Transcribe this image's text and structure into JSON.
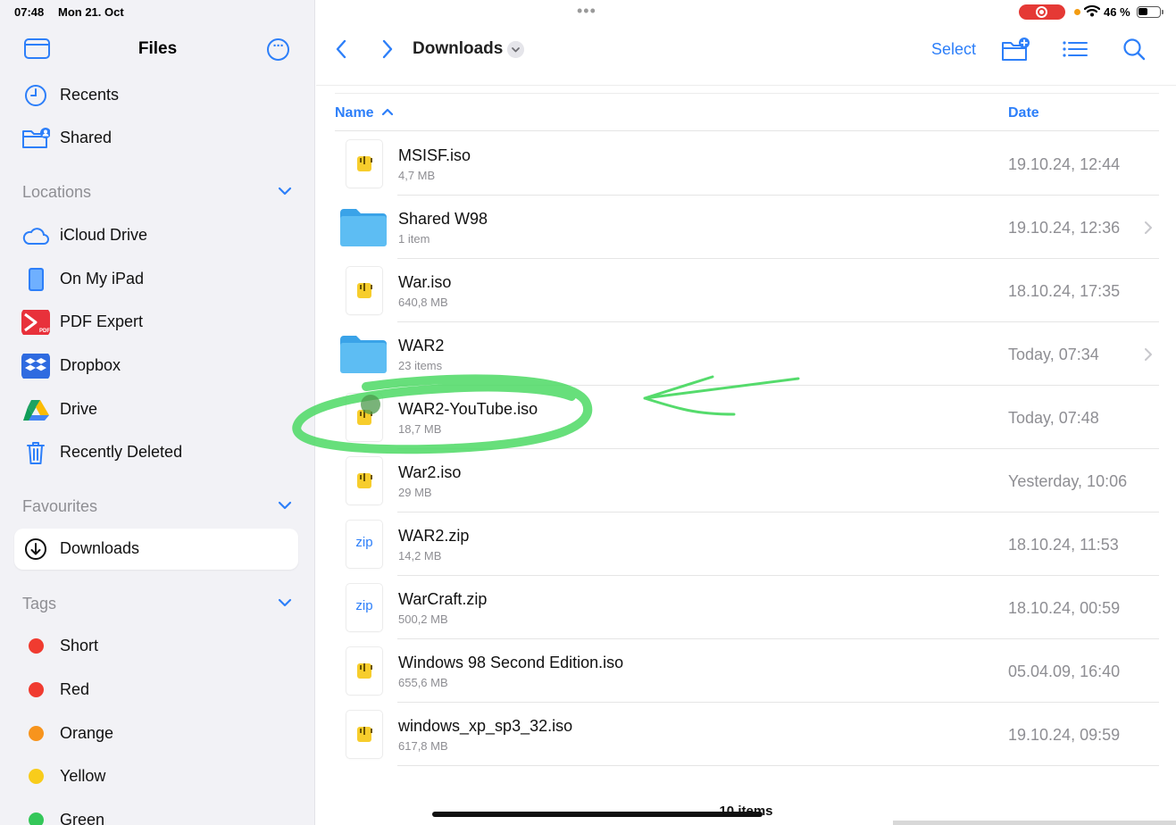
{
  "status_bar": {
    "time": "07:48",
    "date": "Mon 21. Oct",
    "battery_percent_label": "46 %",
    "battery_level": 0.46,
    "recording": true
  },
  "sidebar": {
    "title": "Files",
    "top_items": [
      {
        "label": "Recents",
        "icon": "clock-icon"
      },
      {
        "label": "Shared",
        "icon": "shared-folder-icon"
      }
    ],
    "locations": {
      "header": "Locations",
      "items": [
        {
          "label": "iCloud Drive",
          "icon": "cloud-icon"
        },
        {
          "label": "On My iPad",
          "icon": "ipad-icon"
        },
        {
          "label": "PDF Expert",
          "icon": "pdf-expert-icon"
        },
        {
          "label": "Dropbox",
          "icon": "dropbox-icon"
        },
        {
          "label": "Drive",
          "icon": "google-drive-icon"
        },
        {
          "label": "Recently Deleted",
          "icon": "trash-icon"
        }
      ]
    },
    "favourites": {
      "header": "Favourites",
      "items": [
        {
          "label": "Downloads",
          "icon": "download-circle-icon",
          "selected": true
        }
      ]
    },
    "tags": {
      "header": "Tags",
      "items": [
        {
          "label": "Short",
          "color": "#f03b30"
        },
        {
          "label": "Red",
          "color": "#f03b30"
        },
        {
          "label": "Orange",
          "color": "#f7941d"
        },
        {
          "label": "Yellow",
          "color": "#f8cc1b"
        },
        {
          "label": "Green",
          "color": "#34c759"
        }
      ]
    }
  },
  "toolbar": {
    "folder_title": "Downloads",
    "select_label": "Select"
  },
  "list": {
    "columns": {
      "name": "Name",
      "date": "Date"
    },
    "rows": [
      {
        "name": "MSISF.iso",
        "size": "4,7 MB",
        "date": "19.10.24, 12:44",
        "kind": "archive"
      },
      {
        "name": "Shared W98",
        "size": "1 item",
        "date": "19.10.24, 12:36",
        "kind": "folder"
      },
      {
        "name": "War.iso",
        "size": "640,8 MB",
        "date": "18.10.24, 17:35",
        "kind": "archive"
      },
      {
        "name": "WAR2",
        "size": "23 items",
        "date": "Today, 07:34",
        "kind": "folder"
      },
      {
        "name": "WAR2-YouTube.iso",
        "size": "18,7 MB",
        "date": "Today, 07:48",
        "kind": "archive"
      },
      {
        "name": "War2.iso",
        "size": "29 MB",
        "date": "Yesterday, 10:06",
        "kind": "archive"
      },
      {
        "name": "WAR2.zip",
        "size": "14,2 MB",
        "date": "18.10.24, 11:53",
        "kind": "zip"
      },
      {
        "name": "WarCraft.zip",
        "size": "500,2 MB",
        "date": "18.10.24, 00:59",
        "kind": "zip"
      },
      {
        "name": "Windows 98 Second Edition.iso",
        "size": "655,6 MB",
        "date": "05.04.09, 16:40",
        "kind": "archive"
      },
      {
        "name": "windows_xp_sp3_32.iso",
        "size": "617,8 MB",
        "date": "19.10.24, 09:59",
        "kind": "archive"
      }
    ],
    "zip_badge": "zip",
    "footer": "10 items"
  },
  "colors": {
    "accent": "#2d7ff9",
    "annotation": "#4cd964",
    "record": "#e53935"
  }
}
